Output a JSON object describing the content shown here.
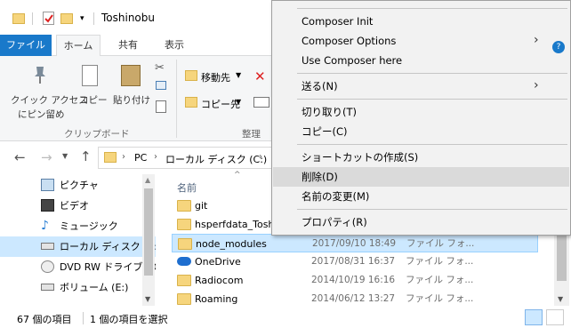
{
  "window": {
    "title": "Toshinobu"
  },
  "ribbon_tabs": {
    "file": "ファイル",
    "home": "ホーム",
    "share": "共有",
    "view": "表示"
  },
  "ribbon": {
    "pin_quick_access_1": "クイック アクセス",
    "pin_quick_access_2": "にピン留め",
    "copy": "コピー",
    "paste": "貼り付け",
    "group_clipboard": "クリップボード",
    "move_to": "移動先",
    "copy_to": "コピー先",
    "group_organize": "整理"
  },
  "address": {
    "seg_pc": "PC",
    "seg_local": "ローカル ディスク (C:)"
  },
  "nav": {
    "items": [
      {
        "label": "ピクチャ",
        "icon": "pictures-icon"
      },
      {
        "label": "ビデオ",
        "icon": "video-icon"
      },
      {
        "label": "ミュージック",
        "icon": "music-icon"
      },
      {
        "label": "ローカル ディスク (C:)",
        "icon": "drive-icon"
      },
      {
        "label": "DVD RW ドライブ (D",
        "icon": "dvd-icon"
      },
      {
        "label": "ボリューム (E:)",
        "icon": "volume-icon"
      }
    ]
  },
  "content": {
    "header_name": "名前",
    "rows": [
      {
        "name": "git",
        "date": "",
        "type": ""
      },
      {
        "name": "hsperfdata_Tosh",
        "date": "",
        "type": ""
      },
      {
        "name": "node_modules",
        "date": "2017/09/10 18:49",
        "type": "ファイル フォ..."
      },
      {
        "name": "OneDrive",
        "date": "2017/08/31 16:37",
        "type": "ファイル フォ..."
      },
      {
        "name": "Radiocom",
        "date": "2014/10/19 16:16",
        "type": "ファイル フォ..."
      },
      {
        "name": "Roaming",
        "date": "2014/06/12 13:27",
        "type": "ファイル フォ..."
      }
    ]
  },
  "status": {
    "count": "67 個の項目",
    "selected": "1 個の項目を選択"
  },
  "context_menu": {
    "composer_init": "Composer Init",
    "composer_options": "Composer Options",
    "use_composer": "Use Composer here",
    "send_to": "送る(N)",
    "cut": "切り取り(T)",
    "copy": "コピー(C)",
    "create_shortcut": "ショートカットの作成(S)",
    "delete": "削除(D)",
    "rename": "名前の変更(M)",
    "properties": "プロパティ(R)"
  },
  "colors": {
    "accent": "#1979ca",
    "selection": "#cce8ff",
    "menu_hover": "#dadada"
  }
}
